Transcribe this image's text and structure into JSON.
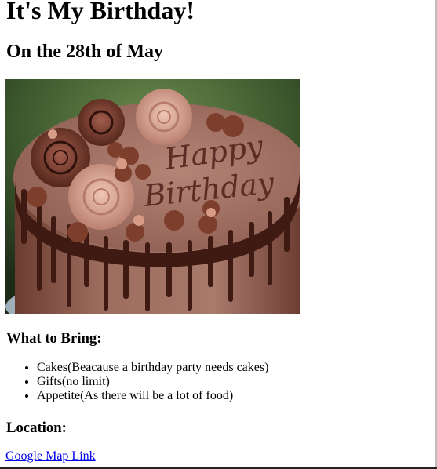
{
  "page": {
    "title": "It's My Birthday!",
    "date": "On the 28th of May"
  },
  "image": {
    "cake_text_line1": "Happy",
    "cake_text_line2": "Birthday"
  },
  "bring": {
    "heading": "What to Bring:",
    "items": [
      "Cakes(Beacause a birthday party needs cakes)",
      "Gifts(no limit)",
      "Appetite(As there will be a lot of food)"
    ]
  },
  "location": {
    "heading": "Location:",
    "link_text": "Google Map Link"
  },
  "colors": {
    "link": "#0000ee",
    "chocolate": "#5a2e24",
    "frosting": "#a9756a"
  }
}
